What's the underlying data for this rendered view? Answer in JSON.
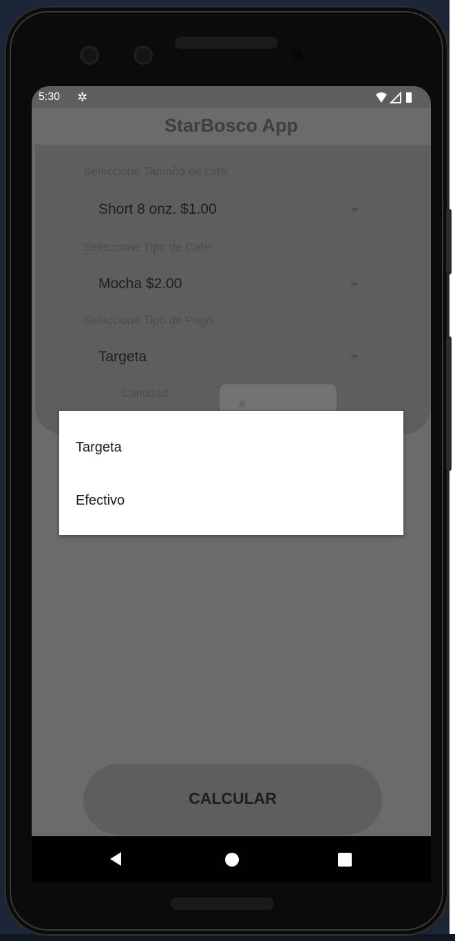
{
  "status_bar": {
    "time": "5:30",
    "icons": [
      "gear-icon",
      "wifi-icon",
      "signal-icon",
      "battery-icon"
    ]
  },
  "app": {
    "title": "StarBosco App",
    "size_label": "Seleccione Tamaño de cafe:",
    "size_value": "Short 8 onz. $1.00",
    "type_label": "Seleccione Tipo de Cafe:",
    "type_value": "Mocha $2.00",
    "payment_label": "Seleccione Tipo de Pago:",
    "payment_value": "Targeta",
    "quantity_label": "Cantidad:",
    "quantity_placeholder": "#",
    "calculate_button": "CALCULAR"
  },
  "dropdown": {
    "options": [
      "Targeta",
      "Efectivo"
    ]
  },
  "nav": {
    "icons": [
      "back-icon",
      "home-icon",
      "recents-icon"
    ]
  },
  "colors": {
    "scrim_background": "#6b6b6b",
    "card_background": "#5e5e5e",
    "dropdown_background": "#ffffff",
    "navbar_background": "#000000"
  }
}
